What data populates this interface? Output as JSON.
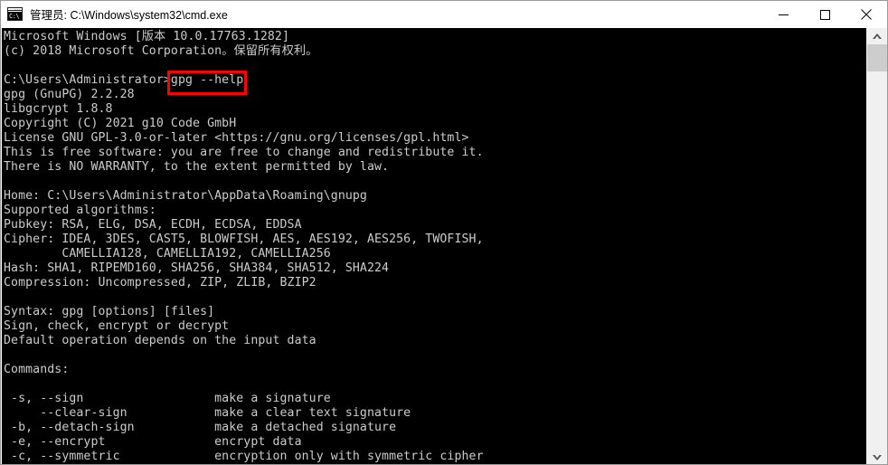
{
  "window": {
    "title": "管理员: C:\\Windows\\system32\\cmd.exe",
    "icon_label": "C:\\",
    "icon_name": "cmd-console-icon"
  },
  "controls": {
    "minimize_label": "Minimize",
    "maximize_label": "Maximize",
    "close_label": "Close"
  },
  "terminal": {
    "content": "Microsoft Windows [版本 10.0.17763.1282]\n(c) 2018 Microsoft Corporation。保留所有权利。\n\nC:\\Users\\Administrator>gpg --help\ngpg (GnuPG) 2.2.28\nlibgcrypt 1.8.8\nCopyright (C) 2021 g10 Code GmbH\nLicense GNU GPL-3.0-or-later <https://gnu.org/licenses/gpl.html>\nThis is free software: you are free to change and redistribute it.\nThere is NO WARRANTY, to the extent permitted by law.\n\nHome: C:\\Users\\Administrator\\AppData\\Roaming\\gnupg\nSupported algorithms:\nPubkey: RSA, ELG, DSA, ECDH, ECDSA, EDDSA\nCipher: IDEA, 3DES, CAST5, BLOWFISH, AES, AES192, AES256, TWOFISH,\n        CAMELLIA128, CAMELLIA192, CAMELLIA256\nHash: SHA1, RIPEMD160, SHA256, SHA384, SHA512, SHA224\nCompression: Uncompressed, ZIP, ZLIB, BZIP2\n\nSyntax: gpg [options] [files]\nSign, check, encrypt or decrypt\nDefault operation depends on the input data\n\nCommands:\n\n -s, --sign                  make a signature\n     --clear-sign            make a clear text signature\n -b, --detach-sign           make a detached signature\n -e, --encrypt               encrypt data\n -c, --symmetric             encryption only with symmetric cipher",
    "lines": [
      "Microsoft Windows [版本 10.0.17763.1282]",
      "(c) 2018 Microsoft Corporation。保留所有权利。",
      "",
      "C:\\Users\\Administrator>gpg --help",
      "gpg (GnuPG) 2.2.28",
      "libgcrypt 1.8.8",
      "Copyright (C) 2021 g10 Code GmbH",
      "License GNU GPL-3.0-or-later <https://gnu.org/licenses/gpl.html>",
      "This is free software: you are free to change and redistribute it.",
      "There is NO WARRANTY, to the extent permitted by law.",
      "",
      "Home: C:\\Users\\Administrator\\AppData\\Roaming\\gnupg",
      "Supported algorithms:",
      "Pubkey: RSA, ELG, DSA, ECDH, ECDSA, EDDSA",
      "Cipher: IDEA, 3DES, CAST5, BLOWFISH, AES, AES192, AES256, TWOFISH,",
      "        CAMELLIA128, CAMELLIA192, CAMELLIA256",
      "Hash: SHA1, RIPEMD160, SHA256, SHA384, SHA512, SHA224",
      "Compression: Uncompressed, ZIP, ZLIB, BZIP2",
      "",
      "Syntax: gpg [options] [files]",
      "Sign, check, encrypt or decrypt",
      "Default operation depends on the input data",
      "",
      "Commands:",
      "",
      " -s, --sign                  make a signature",
      "     --clear-sign            make a clear text signature",
      " -b, --detach-sign           make a detached signature",
      " -e, --encrypt               encrypt data",
      " -c, --symmetric             encryption only with symmetric cipher"
    ],
    "prompt": "C:\\Users\\Administrator>",
    "typed_command": "gpg --help",
    "version": "gpg (GnuPG) 2.2.28",
    "libgcrypt_version": "libgcrypt 1.8.8",
    "copyright": "Copyright (C) 2021 g10 Code GmbH",
    "license": "License GNU GPL-3.0-or-later <https://gnu.org/licenses/gpl.html>",
    "home_path": "C:\\Users\\Administrator\\AppData\\Roaming\\gnupg",
    "algorithms": {
      "pubkey": "RSA, ELG, DSA, ECDH, ECDSA, EDDSA",
      "cipher": "IDEA, 3DES, CAST5, BLOWFISH, AES, AES192, AES256, TWOFISH, CAMELLIA128, CAMELLIA192, CAMELLIA256",
      "hash": "SHA1, RIPEMD160, SHA256, SHA384, SHA512, SHA224",
      "compression": "Uncompressed, ZIP, ZLIB, BZIP2"
    },
    "commands": [
      {
        "flag": "-s, --sign",
        "description": "make a signature"
      },
      {
        "flag": "--clear-sign",
        "description": "make a clear text signature"
      },
      {
        "flag": "-b, --detach-sign",
        "description": "make a detached signature"
      },
      {
        "flag": "-e, --encrypt",
        "description": "encrypt data"
      },
      {
        "flag": "-c, --symmetric",
        "description": "encryption only with symmetric cipher"
      }
    ]
  },
  "annotation": {
    "highlight_color": "#ff0000",
    "highlighted_text": "gpg --help"
  },
  "colors": {
    "terminal_background": "#000000",
    "terminal_foreground": "#cccccc",
    "titlebar_background": "#ffffff",
    "scrollbar_track": "#f0f0f0",
    "scrollbar_thumb": "#cdcdcd"
  },
  "scrollbar": {
    "up_arrow": "chevron-up",
    "down_arrow": "chevron-down"
  }
}
